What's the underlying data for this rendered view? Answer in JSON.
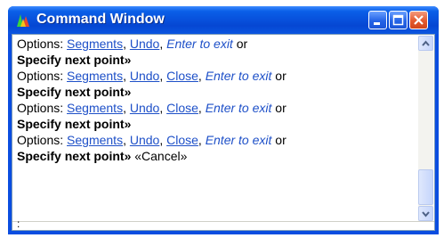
{
  "window": {
    "title": "Command Window",
    "icon": "app-logo-icon",
    "buttons": {
      "minimize": "minimize-icon",
      "maximize": "maximize-icon",
      "close": "close-icon"
    }
  },
  "history": [
    {
      "type": "options",
      "label": "Options:",
      "items": [
        "Segments",
        "Undo"
      ],
      "exit": "Enter to exit",
      "tail": "or"
    },
    {
      "type": "prompt",
      "text": "Specify next point»",
      "extra": ""
    },
    {
      "type": "options",
      "label": "Options:",
      "items": [
        "Segments",
        "Undo",
        "Close"
      ],
      "exit": "Enter to exit",
      "tail": "or"
    },
    {
      "type": "prompt",
      "text": "Specify next point»",
      "extra": ""
    },
    {
      "type": "options",
      "label": "Options:",
      "items": [
        "Segments",
        "Undo",
        "Close"
      ],
      "exit": "Enter to exit",
      "tail": "or"
    },
    {
      "type": "prompt",
      "text": "Specify next point»",
      "extra": ""
    },
    {
      "type": "options",
      "label": "Options:",
      "items": [
        "Segments",
        "Undo",
        "Close"
      ],
      "exit": "Enter to exit",
      "tail": "or"
    },
    {
      "type": "prompt",
      "text": "Specify next point»",
      "extra": "«Cancel»"
    }
  ],
  "input": {
    "prompt": ":"
  },
  "colors": {
    "option_link": "#1e50c8",
    "titlebar": "#0647d3",
    "close_button": "#e45a2f"
  }
}
